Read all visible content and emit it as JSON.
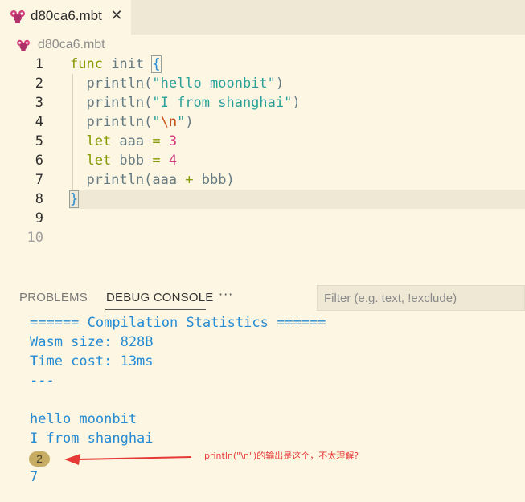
{
  "tab": {
    "icon": "moonbit-file-icon",
    "label": "d80ca6.mbt",
    "close_label": "✕"
  },
  "breadcrumb": {
    "icon": "moonbit-file-icon",
    "label": "d80ca6.mbt"
  },
  "editor": {
    "current_line": 8,
    "lines": [
      {
        "number": "1",
        "tokens": [
          {
            "t": "func",
            "c": "kw"
          },
          {
            "t": " init ",
            "c": "plain"
          },
          {
            "t": "{",
            "c": "brace"
          }
        ]
      },
      {
        "number": "2",
        "tokens": [
          {
            "t": "  println(",
            "c": "plain"
          },
          {
            "t": "\"hello moonbit\"",
            "c": "str"
          },
          {
            "t": ")",
            "c": "plain"
          }
        ]
      },
      {
        "number": "3",
        "tokens": [
          {
            "t": "  println(",
            "c": "plain"
          },
          {
            "t": "\"I from shanghai\"",
            "c": "str"
          },
          {
            "t": ")",
            "c": "plain"
          }
        ]
      },
      {
        "number": "4",
        "tokens": [
          {
            "t": "  println(",
            "c": "plain"
          },
          {
            "t": "\"",
            "c": "str"
          },
          {
            "t": "\\n",
            "c": "esc"
          },
          {
            "t": "\"",
            "c": "str"
          },
          {
            "t": ")",
            "c": "plain"
          }
        ]
      },
      {
        "number": "5",
        "tokens": [
          {
            "t": "  let",
            "c": "kw"
          },
          {
            "t": " aaa ",
            "c": "plain"
          },
          {
            "t": "=",
            "c": "op"
          },
          {
            "t": " ",
            "c": "plain"
          },
          {
            "t": "3",
            "c": "num"
          }
        ]
      },
      {
        "number": "6",
        "tokens": [
          {
            "t": "  let",
            "c": "kw"
          },
          {
            "t": " bbb ",
            "c": "plain"
          },
          {
            "t": "=",
            "c": "op"
          },
          {
            "t": " ",
            "c": "plain"
          },
          {
            "t": "4",
            "c": "num"
          }
        ]
      },
      {
        "number": "7",
        "tokens": [
          {
            "t": "  println(aaa ",
            "c": "plain"
          },
          {
            "t": "+",
            "c": "op"
          },
          {
            "t": " bbb)",
            "c": "plain"
          }
        ]
      },
      {
        "number": "8",
        "tokens": [
          {
            "t": "}",
            "c": "brace"
          }
        ]
      },
      {
        "number": "9",
        "tokens": []
      },
      {
        "number": "10",
        "tokens": []
      }
    ]
  },
  "panel": {
    "tabs": [
      {
        "label": "PROBLEMS",
        "active": false
      },
      {
        "label": "DEBUG CONSOLE",
        "active": true
      }
    ],
    "more_label": "···",
    "filter_placeholder": "Filter (e.g. text, !exclude)",
    "filter_value": "",
    "console_lines": [
      "====== Compilation Statistics ======",
      "Wasm size: 828B",
      "Time cost: 13ms",
      "---",
      "",
      "hello moonbit",
      "I from shanghai"
    ],
    "repeat_count": "2",
    "last_line": "7"
  },
  "annotation": {
    "text": "println(\"\\n\")的输出是这个，不太理解?",
    "color": "#e53935"
  },
  "colors": {
    "background": "#fdf6e3",
    "tab_bar": "#eee8d5",
    "keyword": "#859900",
    "string": "#2aa198",
    "number": "#d33682",
    "escape": "#cb4b16",
    "brace": "#268bd2",
    "console_text": "#268bd2",
    "badge": "#c7ac63"
  }
}
